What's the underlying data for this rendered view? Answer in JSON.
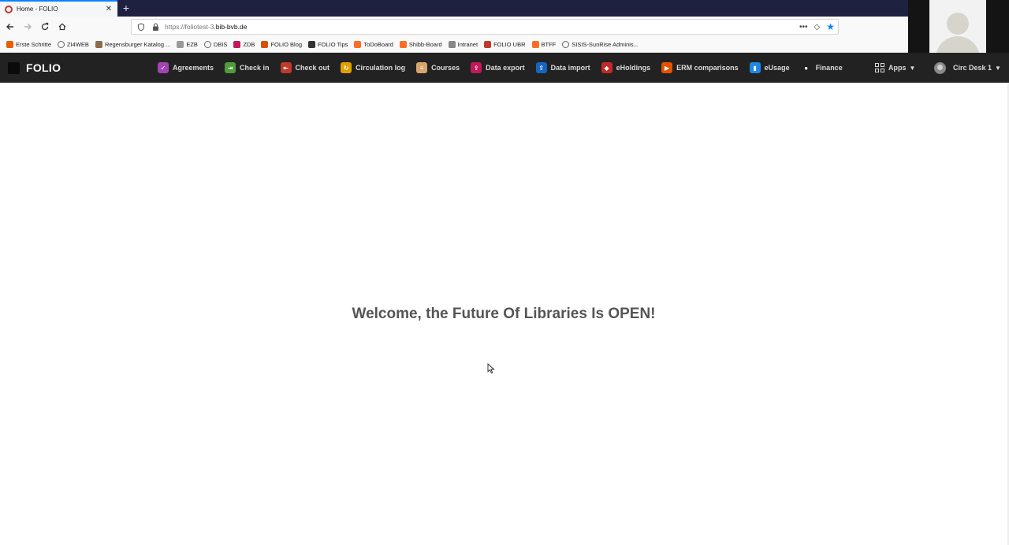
{
  "browser": {
    "tab": {
      "title": "Home - FOLIO",
      "close": "✕"
    },
    "new_tab": "+",
    "url": {
      "prefix": "https://foliotest-3.",
      "domain": "bib-bvb.de"
    },
    "url_actions": {
      "more": "•••",
      "pocket": "◇",
      "star": "★"
    },
    "bookmarks": [
      {
        "label": "Erste Schritte",
        "icon": "firefox-icon",
        "color": "#e66000"
      },
      {
        "label": "ZI4WEB",
        "icon": "globe-icon",
        "color": "#666666"
      },
      {
        "label": "Regensburger Katalog ...",
        "icon": "library-icon",
        "color": "#8a6d4b"
      },
      {
        "label": "EZB",
        "icon": "ezb-icon",
        "color": "#9a9a9a"
      },
      {
        "label": "DBIS",
        "icon": "globe-icon",
        "color": "#666666"
      },
      {
        "label": "ZDB",
        "icon": "zdb-icon",
        "color": "#c2185b"
      },
      {
        "label": "FOLIO Blog",
        "icon": "folio-icon",
        "color": "#d35400"
      },
      {
        "label": "FOLIO Tips",
        "icon": "folio-icon",
        "color": "#333333"
      },
      {
        "label": "ToDoBoard",
        "icon": "gitlab-icon",
        "color": "#fc6d26"
      },
      {
        "label": "Shibb-Board",
        "icon": "gitlab-icon",
        "color": "#fc6d26"
      },
      {
        "label": "Intranet",
        "icon": "intranet-icon",
        "color": "#888888"
      },
      {
        "label": "FOLIO UBR",
        "icon": "target-icon",
        "color": "#c0392b"
      },
      {
        "label": "BTFF",
        "icon": "gitlab-icon",
        "color": "#fc6d26"
      },
      {
        "label": "SISIS-SunRise Adminis...",
        "icon": "globe-icon",
        "color": "#666666"
      }
    ]
  },
  "folio": {
    "logo": "FOLIO",
    "apps": [
      {
        "label": "Agreements",
        "icon": "agreements-icon",
        "color": "#a243b5",
        "glyph": "✓"
      },
      {
        "label": "Check in",
        "icon": "check-in-icon",
        "color": "#4f9c3d",
        "glyph": "⇥"
      },
      {
        "label": "Check out",
        "icon": "check-out-icon",
        "color": "#c0392b",
        "glyph": "⇤"
      },
      {
        "label": "Circulation log",
        "icon": "circulation-log-icon",
        "color": "#e0a100",
        "glyph": "↻"
      },
      {
        "label": "Courses",
        "icon": "courses-icon",
        "color": "#d7a46b",
        "glyph": "≡"
      },
      {
        "label": "Data export",
        "icon": "data-export-icon",
        "color": "#c2185b",
        "glyph": "⇪"
      },
      {
        "label": "Data import",
        "icon": "data-import-icon",
        "color": "#1565c0",
        "glyph": "⇧"
      },
      {
        "label": "eHoldings",
        "icon": "eholdings-icon",
        "color": "#c62828",
        "glyph": "◆"
      },
      {
        "label": "ERM comparisons",
        "icon": "erm-comparisons-icon",
        "color": "#e65100",
        "glyph": "▶"
      },
      {
        "label": "eUsage",
        "icon": "eusage-icon",
        "color": "#1e88e5",
        "glyph": "▮"
      },
      {
        "label": "Finance",
        "icon": "finance-icon",
        "color": "#222222",
        "glyph": "●"
      }
    ],
    "apps_menu": "Apps",
    "user_menu": "Circ Desk 1",
    "welcome": "Welcome, the Future Of Libraries Is OPEN!"
  }
}
